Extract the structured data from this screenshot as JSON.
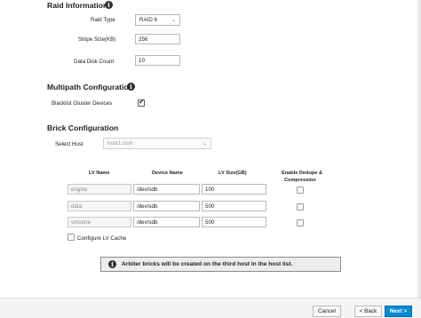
{
  "raid": {
    "title": "Raid Information",
    "raid_type_label": "Raid Type",
    "raid_type_value": "RAID 6",
    "stripe_size_label": "Stripe Size(KB)",
    "stripe_size_value": "256",
    "data_disk_label": "Data Disk Count",
    "data_disk_value": "10"
  },
  "multipath": {
    "title": "Multipath Configuration",
    "blacklist_label": "Blacklist Gluster Devices",
    "blacklist_checked": true
  },
  "brick": {
    "title": "Brick Configuration",
    "select_host_label": "Select Host",
    "select_host_value": "host1.com",
    "columns": {
      "lv_name": "LV Name",
      "device_name": "Device Name",
      "lv_size": "LV Size(GB)",
      "dedupe_line1": "Enable Dedupe &",
      "dedupe_line2": "Compression"
    },
    "rows": [
      {
        "lv_name": "engine",
        "device": "/dev/sdb",
        "size": "100",
        "dedupe": false
      },
      {
        "lv_name": "data",
        "device": "/dev/sdb",
        "size": "500",
        "dedupe": false
      },
      {
        "lv_name": "vmstore",
        "device": "/dev/sdb",
        "size": "500",
        "dedupe": false
      }
    ],
    "configure_lv_cache_label": "Configure LV Cache",
    "configure_lv_cache_checked": false
  },
  "alert": {
    "text": "Arbiter bricks will be created on the third host in the host list."
  },
  "footer": {
    "cancel_label": "Cancel",
    "back_label": "< Back",
    "next_label": "Next >"
  },
  "colors": {
    "primary": "#0a88d0"
  }
}
